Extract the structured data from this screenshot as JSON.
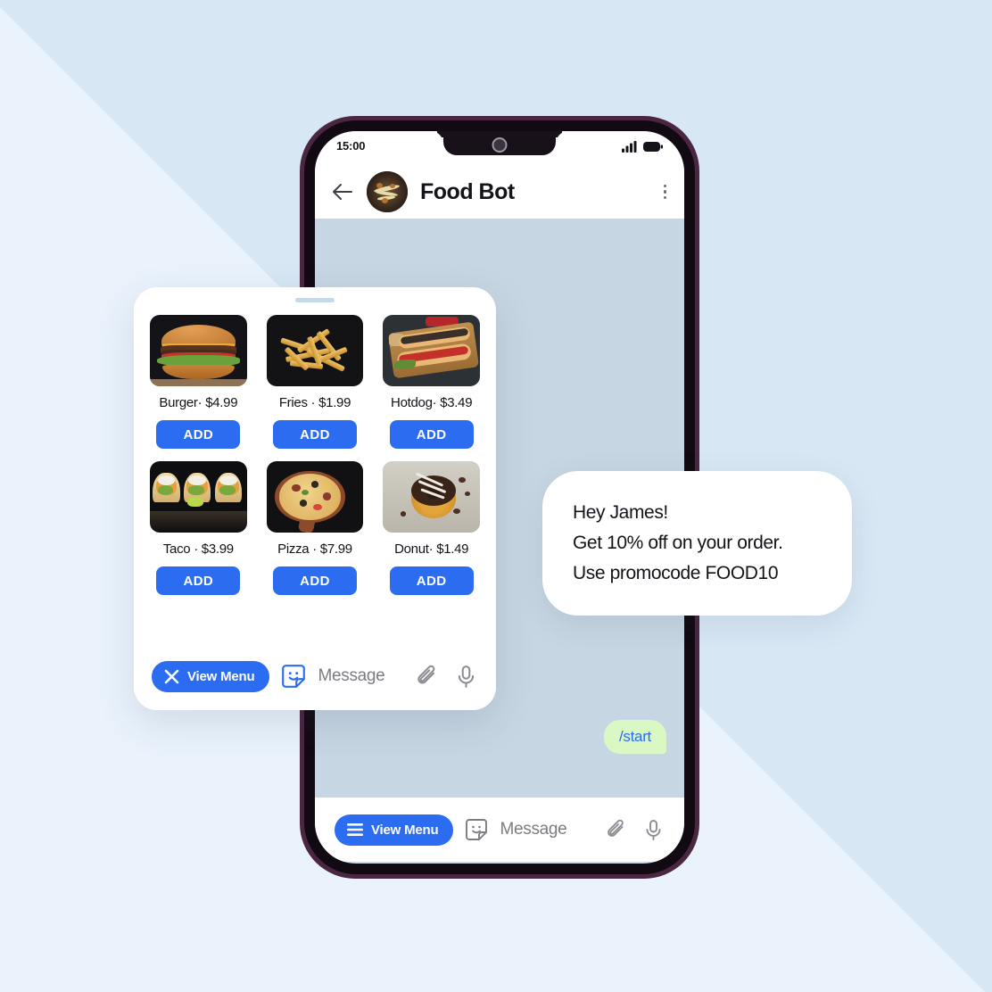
{
  "background": {
    "base_color": "#dbe9f7",
    "accent_color": "#eaf3fc"
  },
  "phone": {
    "frame_color": "#4a2640",
    "body_color": "#120a12",
    "status_bar": {
      "time": "15:00",
      "signal_icon": "signal-bars-icon",
      "battery_icon": "battery-icon"
    },
    "chat_header": {
      "back_icon": "back-arrow-icon",
      "avatar_icon": "bot-avatar",
      "title": "Food Bot",
      "more_icon": "more-vertical-icon"
    },
    "chat_body": {
      "background_color": "#c6d6e2",
      "messages": [
        {
          "text": "/start",
          "side": "outgoing",
          "bubble_color": "#d9f8c4",
          "text_color": "#2b6cf0"
        }
      ]
    },
    "input_bar": {
      "menu_button_label": "View Menu",
      "menu_button_icon": "hamburger-icon",
      "menu_button_color": "#2b6cf0",
      "sticker_icon": "sticker-smiley-icon",
      "message_placeholder": "Message",
      "attach_icon": "paperclip-icon",
      "mic_icon": "microphone-icon"
    }
  },
  "menu_panel": {
    "drag_handle_icon": "drag-handle",
    "items": [
      {
        "name": "Burger",
        "separator": "·",
        "price": "$4.99",
        "add_label": "ADD",
        "image": "burger-photo"
      },
      {
        "name": "Fries",
        "separator": "·",
        "price": "$1.99",
        "add_label": "ADD",
        "image": "fries-photo"
      },
      {
        "name": "Hotdog",
        "separator": "·",
        "price": "$3.49",
        "add_label": "ADD",
        "image": "hotdog-photo"
      },
      {
        "name": "Taco",
        "separator": "·",
        "price": "$3.99",
        "add_label": "ADD",
        "image": "taco-photo"
      },
      {
        "name": "Pizza",
        "separator": "·",
        "price": "$7.99",
        "add_label": "ADD",
        "image": "pizza-photo"
      },
      {
        "name": "Donut",
        "separator": "·",
        "price": "$1.49",
        "add_label": "ADD",
        "image": "donut-photo"
      }
    ],
    "input_bar": {
      "menu_button_label": "View Menu",
      "menu_button_icon": "close-x-icon",
      "menu_button_color": "#2b6cf0",
      "sticker_icon": "sticker-smiley-icon",
      "message_placeholder": "Message",
      "attach_icon": "paperclip-icon",
      "mic_icon": "microphone-icon"
    }
  },
  "promo_bubble": {
    "line1": "Hey James!",
    "line2": "Get 10% off on your order.",
    "line3": "Use promocode FOOD10"
  }
}
